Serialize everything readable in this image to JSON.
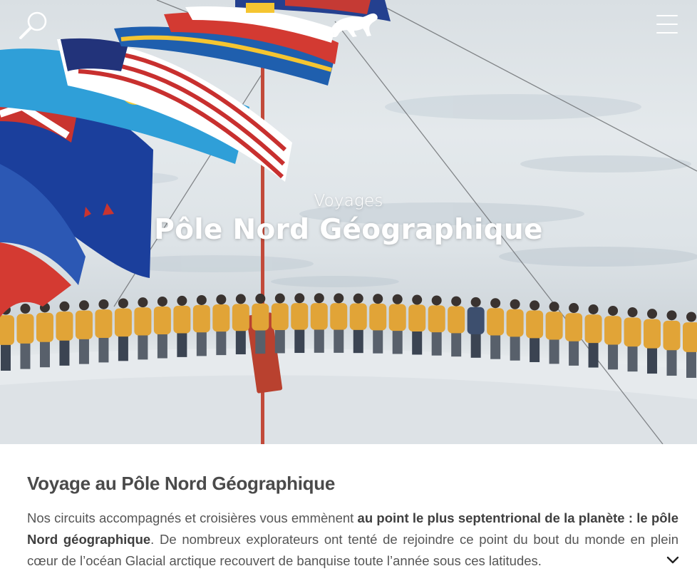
{
  "header": {
    "search_icon": "search-icon",
    "logo_icon": "polar-bear-logo-icon",
    "menu_icon": "hamburger-menu-icon"
  },
  "hero": {
    "kicker": "Voyages",
    "title": "Pôle Nord Géographique"
  },
  "content": {
    "heading": "Voyage au Pôle Nord Géographique",
    "intro_part1": "Nos circuits accompagnés et croisières vous emmènent ",
    "intro_bold": "au point le plus septentrional de la planète : le pôle Nord géographique",
    "intro_part2": ". De nombreux explorateurs ont tenté de rejoindre ce point du bout du monde en plein cœur de l’océan Glacial arctique recouvert de banquise toute l’année sous ces latitudes.",
    "expand_icon": "chevron-down-icon"
  },
  "colors": {
    "heading": "#4a4a4a",
    "text": "#555555",
    "jacket": "#e1a437",
    "hero_text": "#ffffff"
  }
}
